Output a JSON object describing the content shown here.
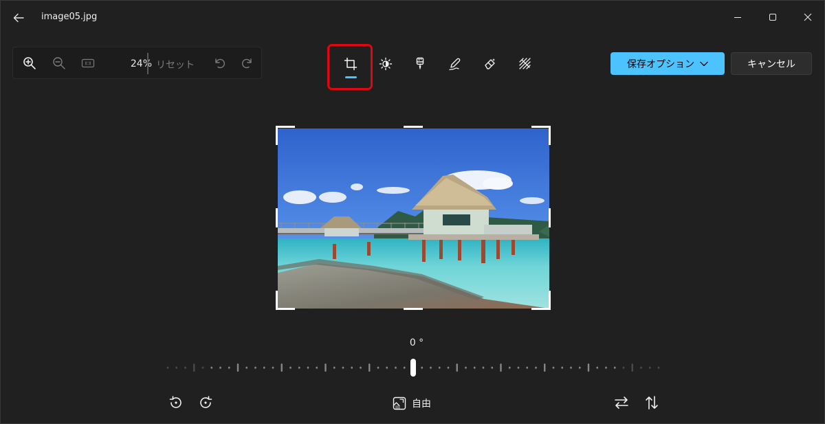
{
  "window": {
    "title": "image05.jpg"
  },
  "zoom": {
    "percent": "24%",
    "reset_label": "リセット"
  },
  "actions": {
    "save_label": "保存オプション",
    "cancel_label": "キャンセル"
  },
  "rotation": {
    "angle_label": "0 °"
  },
  "aspect": {
    "label": "自由"
  },
  "icons": {
    "back": "arrow-left-icon",
    "minimize": "minimize-icon",
    "maximize": "maximize-icon",
    "close": "close-icon",
    "zoom_in": "zoom-in-icon",
    "zoom_out": "zoom-out-icon",
    "actual_size": "actual-size-icon",
    "undo": "undo-icon",
    "redo": "redo-icon",
    "crop": "crop-icon",
    "adjust": "brightness-icon",
    "filter": "filter-brush-icon",
    "markup": "markup-pen-icon",
    "erase": "eraser-icon",
    "background": "background-blur-icon",
    "rotate_left": "rotate-left-icon",
    "rotate_right": "rotate-right-icon",
    "flip_h": "flip-horizontal-icon",
    "flip_v": "flip-vertical-icon",
    "aspect": "aspect-ratio-icon"
  },
  "colors": {
    "accent": "#4cc2ff",
    "highlight": "#e1060f",
    "background": "#202020"
  }
}
